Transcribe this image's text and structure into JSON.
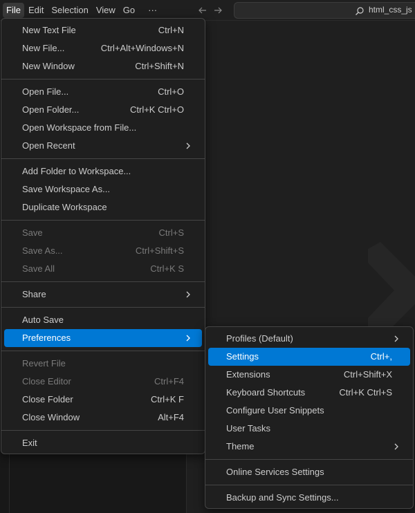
{
  "menubar": {
    "items": [
      "File",
      "Edit",
      "Selection",
      "View",
      "Go"
    ],
    "more": "···"
  },
  "search": {
    "label": "html_css_js"
  },
  "file_menu": {
    "groups": [
      [
        {
          "label": "New Text File",
          "shortcut": "Ctrl+N"
        },
        {
          "label": "New File...",
          "shortcut": "Ctrl+Alt+Windows+N"
        },
        {
          "label": "New Window",
          "shortcut": "Ctrl+Shift+N"
        }
      ],
      [
        {
          "label": "Open File...",
          "shortcut": "Ctrl+O"
        },
        {
          "label": "Open Folder...",
          "shortcut": "Ctrl+K Ctrl+O"
        },
        {
          "label": "Open Workspace from File...",
          "shortcut": ""
        },
        {
          "label": "Open Recent",
          "shortcut": ""
        }
      ],
      [
        {
          "label": "Add Folder to Workspace...",
          "shortcut": ""
        },
        {
          "label": "Save Workspace As...",
          "shortcut": ""
        },
        {
          "label": "Duplicate Workspace",
          "shortcut": ""
        }
      ],
      [
        {
          "label": "Save",
          "shortcut": "Ctrl+S"
        },
        {
          "label": "Save As...",
          "shortcut": "Ctrl+Shift+S"
        },
        {
          "label": "Save All",
          "shortcut": "Ctrl+K S"
        }
      ],
      [
        {
          "label": "Share",
          "shortcut": ""
        }
      ],
      [
        {
          "label": "Auto Save",
          "shortcut": ""
        },
        {
          "label": "Preferences",
          "shortcut": ""
        }
      ],
      [
        {
          "label": "Revert File",
          "shortcut": ""
        },
        {
          "label": "Close Editor",
          "shortcut": "Ctrl+F4"
        },
        {
          "label": "Close Folder",
          "shortcut": "Ctrl+K F"
        },
        {
          "label": "Close Window",
          "shortcut": "Alt+F4"
        }
      ],
      [
        {
          "label": "Exit",
          "shortcut": ""
        }
      ]
    ]
  },
  "preferences_menu": {
    "groups": [
      [
        {
          "label": "Profiles (Default)",
          "shortcut": ""
        },
        {
          "label": "Settings",
          "shortcut": "Ctrl+,"
        },
        {
          "label": "Extensions",
          "shortcut": "Ctrl+Shift+X"
        },
        {
          "label": "Keyboard Shortcuts",
          "shortcut": "Ctrl+K Ctrl+S"
        },
        {
          "label": "Configure User Snippets",
          "shortcut": ""
        },
        {
          "label": "User Tasks",
          "shortcut": ""
        },
        {
          "label": "Theme",
          "shortcut": ""
        }
      ],
      [
        {
          "label": "Online Services Settings",
          "shortcut": ""
        }
      ],
      [
        {
          "label": "Backup and Sync Settings...",
          "shortcut": ""
        }
      ]
    ]
  },
  "colors": {
    "accent": "#0078d4",
    "menu_bg": "#1f1f1f",
    "border": "#454545"
  }
}
